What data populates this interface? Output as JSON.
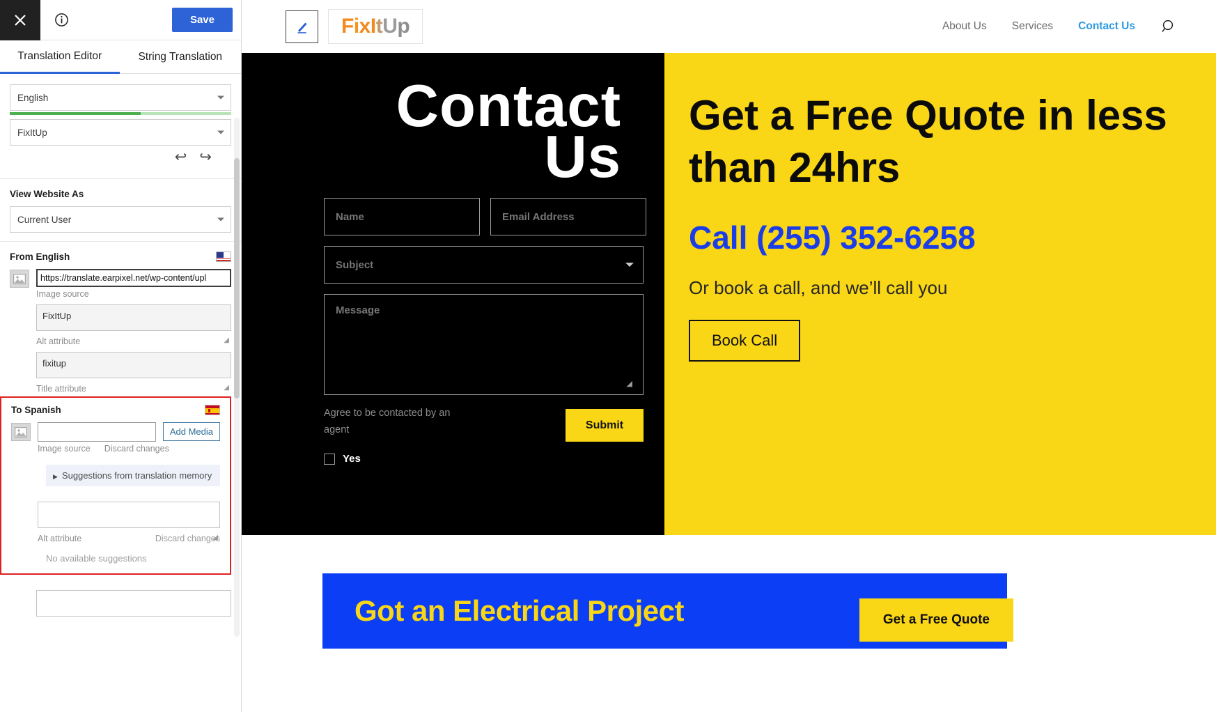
{
  "editor": {
    "close_icon": "close-x-icon",
    "info_icon": "info-circle-icon",
    "save_label": "Save",
    "tabs": [
      {
        "label": "Translation Editor",
        "active": true
      },
      {
        "label": "String Translation",
        "active": false
      }
    ],
    "language_select": {
      "value": "English",
      "icon": "chevron-down-icon"
    },
    "page_select": {
      "value": "FixItUp",
      "icon": "chevron-down-icon"
    },
    "progress_percent": 59,
    "undo_icon": "undo-arrow-icon",
    "redo_icon": "redo-arrow-icon",
    "view_website_as": {
      "label": "View Website As",
      "value": "Current User",
      "icon": "chevron-down-icon"
    },
    "source": {
      "heading": "From English",
      "flag": "flag-us-icon",
      "thumb_icon": "image-placeholder-icon",
      "image_source_value": "https://translate.earpixel.net/wp-content/upl",
      "image_source_hint": "Image source",
      "alt_value": "FixItUp",
      "alt_hint": "Alt attribute",
      "title_value": "fixitup",
      "title_hint": "Title attribute"
    },
    "target": {
      "heading": "To Spanish",
      "flag": "flag-es-icon",
      "thumb_icon": "image-placeholder-icon",
      "image_source_value": "",
      "image_source_placeholder": "",
      "image_source_hint": "Image source",
      "add_media_label": "Add Media",
      "discard_changes_label": "Discard changes",
      "suggestions_label": "Suggestions from translation memory",
      "suggestions_toggle_icon": "triangle-right-icon",
      "alt_value": "",
      "alt_hint": "Alt attribute",
      "alt_discard_label": "Discard changes",
      "no_suggestions_label": "No available suggestions",
      "highlight_color": "#e02121"
    },
    "accent_color": "#2e63d8"
  },
  "site": {
    "edit_icon": "pencil-edit-icon",
    "logo": {
      "letters": [
        "F",
        "i",
        "x",
        "I",
        "t",
        "U",
        "p"
      ],
      "text": "FixItUp"
    },
    "nav": [
      {
        "label": "About Us",
        "active": false
      },
      {
        "label": "Services",
        "active": false
      },
      {
        "label": "Contact Us",
        "active": true
      }
    ],
    "search_icon": "search-magnifier-icon",
    "hero": {
      "title": "Contact Us",
      "bg_dark": "#000000",
      "bg_yellow": "#F9D616",
      "form": {
        "name_placeholder": "Name",
        "email_placeholder": "Email Address",
        "subject_placeholder": "Subject",
        "subject_caret_icon": "chevron-down-icon",
        "message_placeholder": "Message",
        "agree_text": "Agree to be contacted by an agent",
        "submit_label": "Submit",
        "yes_label": "Yes",
        "yes_checked": false
      },
      "right": {
        "headline": "Get a Free Quote in less than 24hrs",
        "phone": "Call (255) 352-6258",
        "phone_color": "#1A3DE8",
        "subtext": "Or book a call, and we’ll call you",
        "book_label": "Book Call"
      }
    },
    "cta": {
      "text": "Got an Electrical Project",
      "button_label": "Get a Free Quote",
      "band_color": "#0B3EF5",
      "accent_color": "#F9D616"
    }
  }
}
